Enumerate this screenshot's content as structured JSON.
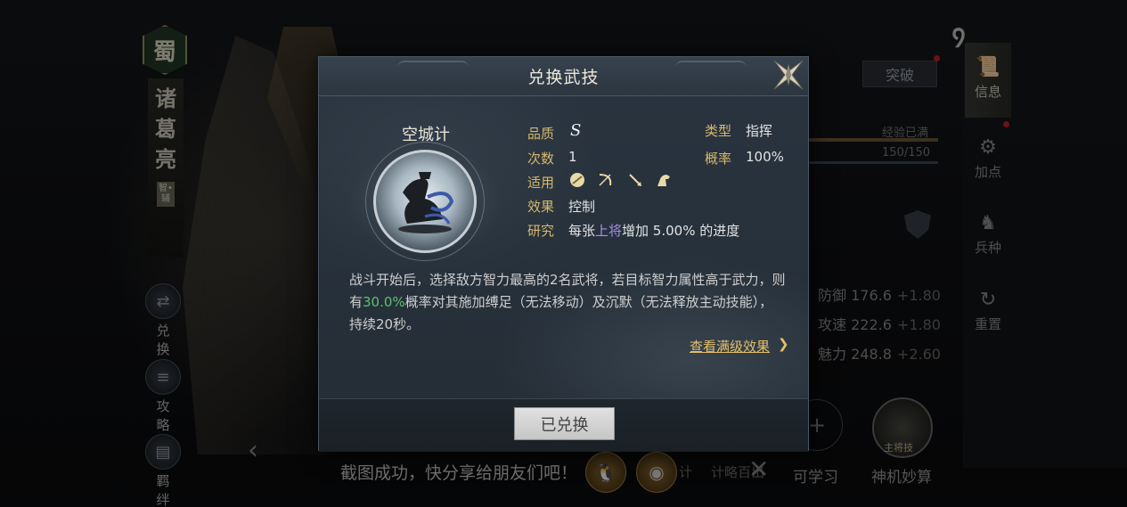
{
  "hero": {
    "faction": "蜀",
    "name_chars": [
      "诸",
      "葛",
      "亮"
    ],
    "role_tag": "智•辅"
  },
  "left_nav": [
    {
      "label": "兑换",
      "icon": "swap-icon"
    },
    {
      "label": "攻略",
      "icon": "scroll-icon"
    },
    {
      "label": "羁绊",
      "icon": "book-icon"
    }
  ],
  "right_rail": [
    {
      "label": "信息",
      "icon": "scroll-icon",
      "active": true
    },
    {
      "label": "加点",
      "icon": "gear-icon",
      "active": false
    },
    {
      "label": "兵种",
      "icon": "horse-icon",
      "active": false
    },
    {
      "label": "重置",
      "icon": "reset-icon",
      "active": false
    }
  ],
  "stats_panel": {
    "breakthrough_label": "突破",
    "exp_label": "经验已满",
    "exp_value": "150/150",
    "stats": [
      {
        "name": "防御",
        "value": "176.6",
        "bonus": "+1.80"
      },
      {
        "name": "攻速",
        "value": "222.6",
        "bonus": "+1.80"
      },
      {
        "name": "魅力",
        "value": "248.8",
        "bonus": "+2.60"
      }
    ],
    "learnable_label": "可学习",
    "skill2_label": "神机妙算",
    "skill2_tag": "主将技"
  },
  "share_toast": {
    "text": "截图成功，快分享给朋友们吧！",
    "behind_texts": [
      "计",
      "计略百出"
    ]
  },
  "modal": {
    "title": "兑换武技",
    "skill_name": "空城计",
    "attributes": {
      "quality_label": "品质",
      "quality_value": "S",
      "type_label": "类型",
      "type_value": "指挥",
      "count_label": "次数",
      "count_value": "1",
      "rate_label": "概率",
      "rate_value": "100%",
      "applicable_label": "适用",
      "applicable_icons": [
        "shield-icon",
        "bow-icon",
        "spear-icon",
        "horse-icon"
      ],
      "effect_label": "效果",
      "effect_value": "控制",
      "research_label": "研究",
      "research_prefix": "每张",
      "research_highlight": "上将",
      "research_suffix": "增加 5.00% 的进度"
    },
    "description": {
      "part1": "战斗开始后，选择敌方智力最高的2名武将，若目标智力属性高于武力，则有",
      "rate": "30.0%",
      "part2": "概率对其施加缚足（无法移动）及沉默（无法释放主动技能），持续20秒。"
    },
    "view_max_label": "查看满级效果",
    "button_label": "已兑换"
  }
}
